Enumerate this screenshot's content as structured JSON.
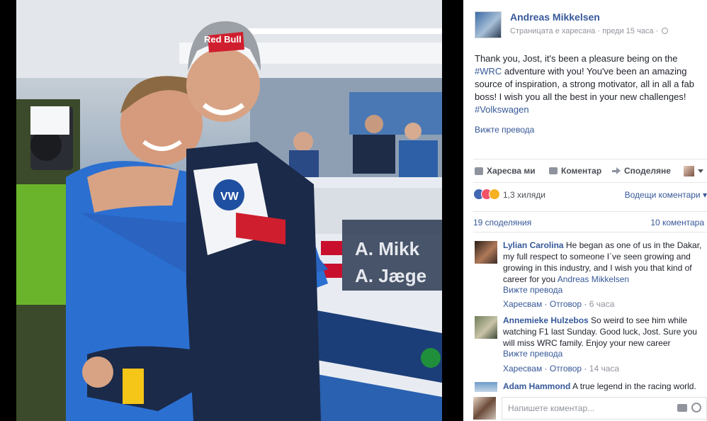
{
  "photo": {
    "cap_text": "Red Bull",
    "car_plate_1": "A. Mikk",
    "car_plate_2": "A. Jæge"
  },
  "post": {
    "page_name": "Andreas Mikkelsen",
    "meta_liked": "Страницата е харесана",
    "meta_time": "преди 15 часа",
    "text_part1": "Thank you, Jost, it's been a pleasure being on the ",
    "hashtag_wrc": "#WRC",
    "text_part2": " adventure with you! You've been an amazing source of inspiration, a strong motivator, all in all a fab boss! I wish you all the best in your new challenges! ",
    "hashtag_vw": "#Volkswagen",
    "see_translation": "Вижте превода"
  },
  "actions": {
    "like": "Харесва ми",
    "comment": "Коментар",
    "share": "Споделяне"
  },
  "reactions": {
    "count": "1,3 хиляди",
    "top_comments": "Водещи коментари"
  },
  "counts": {
    "shares": "19 споделяния",
    "comments": "10 коментара"
  },
  "comments": [
    {
      "author": "Lylian Carolina",
      "text": " He began as one of us in the Dakar, my full respect to someone I´ve seen growing and growing in this industry, and I wish you that kind of career for you ",
      "mention": "Andreas Mikkelsen",
      "see_translation": "Вижте превода",
      "like": "Харесвам",
      "reply": "Отговор",
      "time": "6 часа"
    },
    {
      "author": "Annemieke Hulzebos",
      "text": " So weird to see him while watching F1 last Sunday. Good luck, Jost. Sure you will miss WRC family. Enjoy your new career",
      "see_translation": "Вижте превода",
      "like": "Харесвам",
      "reply": "Отговор",
      "time": "14 часа"
    },
    {
      "author": "Adam Hammond",
      "text": " A true legend in the racing world."
    }
  ],
  "reply": {
    "placeholder": "Напишете коментар..."
  }
}
